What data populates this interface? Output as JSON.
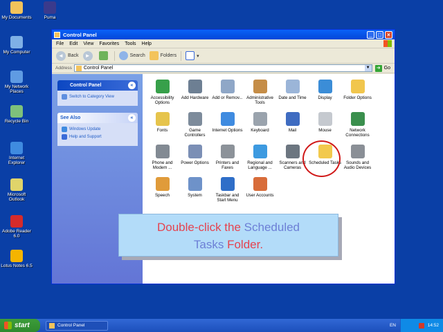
{
  "desktop": {
    "icons": [
      {
        "label": "My Documents",
        "color": "#f3c35b"
      },
      {
        "label": "Puma",
        "color": "#3a3a8c"
      },
      {
        "label": "My Computer",
        "color": "#7fb0e6"
      },
      {
        "label": "My Network Places",
        "color": "#5f9be3"
      },
      {
        "label": "Recycle Bin",
        "color": "#7ec17b"
      },
      {
        "label": "Internet Explorer",
        "color": "#3f8be0"
      },
      {
        "label": "Microsoft Outlook",
        "color": "#e0d46a"
      },
      {
        "label": "Adobe Reader 6.0",
        "color": "#d52b2b"
      },
      {
        "label": "Lotus Notes 6.5",
        "color": "#f5b400"
      }
    ]
  },
  "window": {
    "title": "Control Panel",
    "menu": [
      "File",
      "Edit",
      "View",
      "Favorites",
      "Tools",
      "Help"
    ],
    "toolbar": {
      "back": "Back",
      "search": "Search",
      "folders": "Folders"
    },
    "address": {
      "label": "Address",
      "value": "Control Panel",
      "go": "Go"
    }
  },
  "leftpane": {
    "cp_panel": {
      "title": "Control Panel",
      "link": "Switch to Category View"
    },
    "see_also": {
      "title": "See Also",
      "links": [
        "Windows Update",
        "Help and Support"
      ]
    }
  },
  "items": [
    {
      "label": "Accessibility Options",
      "color": "#37a04a"
    },
    {
      "label": "Add Hardware",
      "color": "#6d7f93"
    },
    {
      "label": "Add or Remov...",
      "color": "#8fa7c7"
    },
    {
      "label": "Administrative Tools",
      "color": "#c58d47"
    },
    {
      "label": "Date and Time",
      "color": "#9bb5d8"
    },
    {
      "label": "Display",
      "color": "#3b8dd7"
    },
    {
      "label": "Folder Options",
      "color": "#f1c64d"
    },
    {
      "label": "Fonts",
      "color": "#e6c44c"
    },
    {
      "label": "Game Controllers",
      "color": "#7d8b9b"
    },
    {
      "label": "Internet Options",
      "color": "#3f8be0"
    },
    {
      "label": "Keyboard",
      "color": "#9aa3ad"
    },
    {
      "label": "Mail",
      "color": "#3f6cc1"
    },
    {
      "label": "Mouse",
      "color": "#c5c9cf"
    },
    {
      "label": "Network Connections",
      "color": "#3a8f4d"
    },
    {
      "label": "Phone and Modem ...",
      "color": "#828a93"
    },
    {
      "label": "Power Options",
      "color": "#7b8fb5"
    },
    {
      "label": "Printers and Faxes",
      "color": "#8c9299"
    },
    {
      "label": "Regional and Language ...",
      "color": "#3d9ae0"
    },
    {
      "label": "Scanners and Cameras",
      "color": "#6c7680"
    },
    {
      "label": "Scheduled Tasks",
      "color": "#f2c94d"
    },
    {
      "label": "Sounds and Audio Devices",
      "color": "#8a8f96"
    },
    {
      "label": "Speech",
      "color": "#e09b3a"
    },
    {
      "label": "System",
      "color": "#6e92c9"
    },
    {
      "label": "Taskbar and Start Menu",
      "color": "#2f6ec8"
    },
    {
      "label": "User Accounts",
      "color": "#d86c3a"
    }
  ],
  "callout": {
    "line1_a": "Double-click the ",
    "line1_b": "Scheduled",
    "line2_a": "Tasks",
    "line2_b": " Folder."
  },
  "taskbar": {
    "start": "start",
    "task": "Control Panel",
    "lang": "EN",
    "time": "14:52"
  }
}
